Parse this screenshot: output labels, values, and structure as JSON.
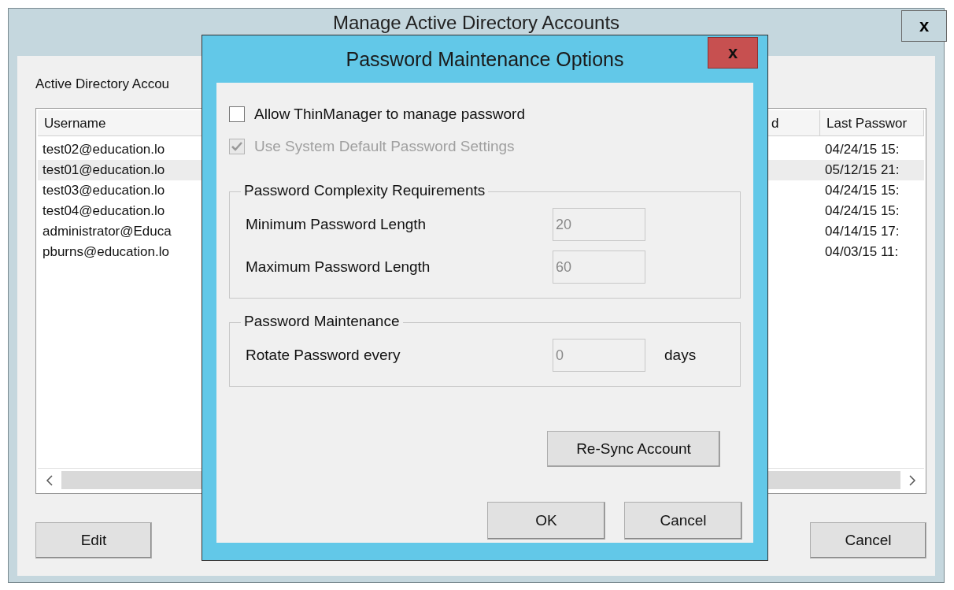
{
  "window": {
    "title": "Manage Active Directory Accounts",
    "close": "x"
  },
  "accounts_label": "Active Directory Accou",
  "table": {
    "columns": [
      "Username",
      "d",
      "Last Passwor"
    ],
    "rows": [
      {
        "username": "test02@education.lo",
        "last_password": "04/24/15 15:",
        "selected": false
      },
      {
        "username": "test01@education.lo",
        "last_password": "05/12/15 21:",
        "selected": true
      },
      {
        "username": "test03@education.lo",
        "last_password": "04/24/15 15:",
        "selected": false
      },
      {
        "username": "test04@education.lo",
        "last_password": "04/24/15 15:",
        "selected": false
      },
      {
        "username": "administrator@Educa",
        "last_password": "04/14/15 17:",
        "selected": false
      },
      {
        "username": "pburns@education.lo",
        "last_password": "04/03/15 11:",
        "selected": false
      }
    ]
  },
  "buttons": {
    "edit": "Edit",
    "cancel": "Cancel"
  },
  "dialog": {
    "title": "Password Maintenance Options",
    "close": "x",
    "checkboxes": [
      {
        "label": "Allow ThinManager to manage password",
        "checked": false,
        "disabled": false
      },
      {
        "label": "Use System Default Password Settings",
        "checked": true,
        "disabled": true
      }
    ],
    "groups": [
      {
        "title": "Password Complexity Requirements",
        "fields": [
          {
            "label": "Minimum Password Length",
            "value": "20",
            "disabled": true
          },
          {
            "label": "Maximum Password Length",
            "value": "60",
            "disabled": true
          }
        ]
      },
      {
        "title": "Password Maintenance",
        "fields": [
          {
            "label": "Rotate Password every",
            "value": "0",
            "unit": "days",
            "disabled": true
          }
        ]
      }
    ],
    "resync": "Re-Sync Account",
    "ok": "OK",
    "cancel": "Cancel"
  }
}
